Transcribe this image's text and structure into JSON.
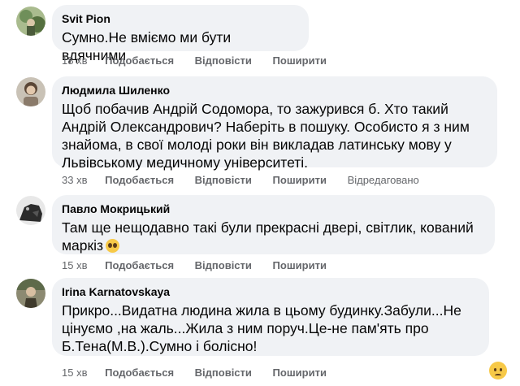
{
  "comments": [
    {
      "author": "Svit Pion",
      "text": "Сумно.Не вміємо ми бути вдячними",
      "time": "18 хв",
      "like": "Подобається",
      "reply": "Відповісти",
      "share": "Поширити",
      "avatar_color": "#6f8f5a"
    },
    {
      "author": "Людмила Шиленко",
      "text_lines": [
        "Щоб побачив Андрій Содомора, то зажурився б. Хто такий",
        "Андрій Олександрович? Наберіть в пошуку. Особисто я з ним",
        "знайома, в свої молоді роки він викладав латинську мову у",
        "Львівському медичному університеті."
      ],
      "time": "33 хв",
      "like": "Подобається",
      "reply": "Відповісти",
      "share": "Поширити",
      "edited": "Відредаговано",
      "avatar_color": "#8a7a6a"
    },
    {
      "author": "Павло Мокрицький",
      "text_lines": [
        "Там ще нещодавно такі були прекрасні двері, світлик, кований",
        "маркіз"
      ],
      "time": "15 хв",
      "like": "Подобається",
      "reply": "Відповісти",
      "share": "Поширити",
      "avatar_color": "#3a3a3a"
    },
    {
      "author": "Irina Karnatovskaya",
      "text_lines": [
        "Прикро...Видатна людина жила в цьому будинку.Забули...Не",
        "цінуємо ,на жаль...Жила з ним поруч.Це-не пам'ять про",
        "Б.Тена(М.В.).Сумно і болісно!"
      ],
      "time": "15 хв",
      "like": "Подобається",
      "reply": "Відповісти",
      "share": "Поширити",
      "avatar_color": "#6a6a55"
    }
  ],
  "colors": {
    "bubble": "#f0f2f5",
    "meta": "#65676b",
    "text": "#050505"
  }
}
